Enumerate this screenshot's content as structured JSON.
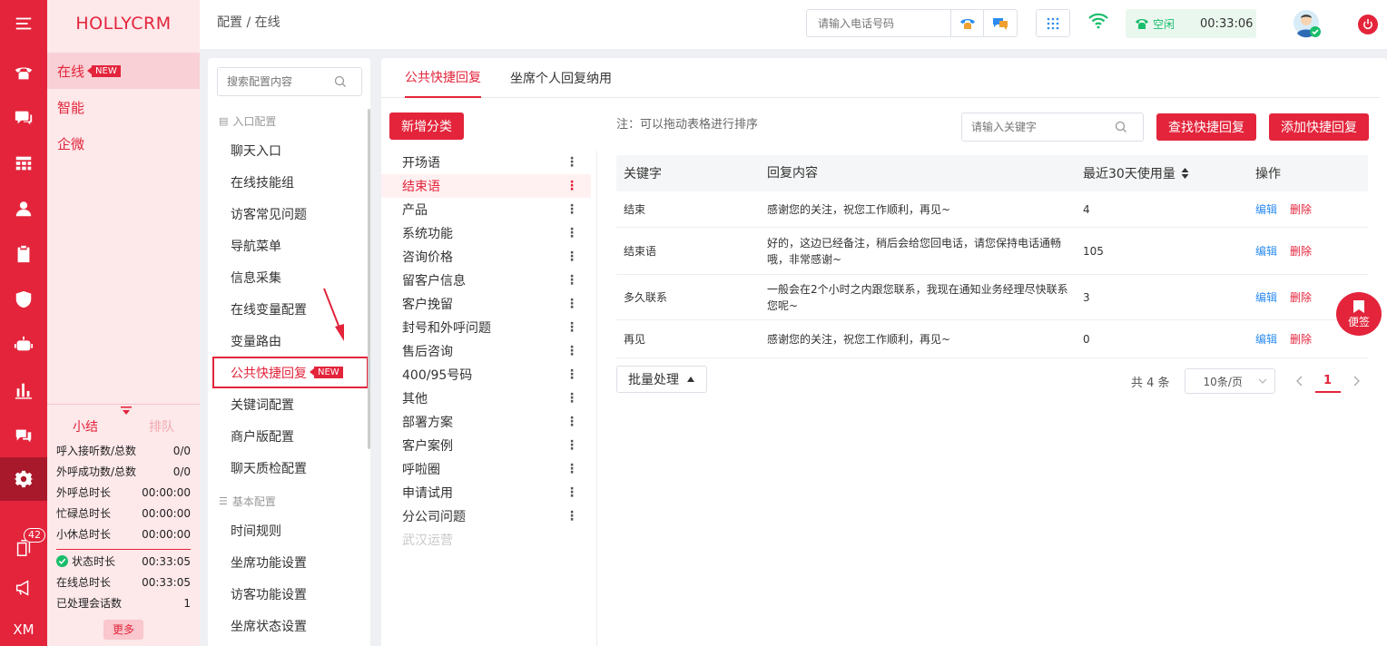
{
  "brand": "HOLLYCRM",
  "breadcrumb": "配置 / 在线",
  "header": {
    "phone_placeholder": "请输入电话号码",
    "status_text": "空闲",
    "status_time": "00:33:06",
    "status_color": "#19be6b"
  },
  "rail": {
    "badge": "42",
    "bottom_label": "XM"
  },
  "nav": {
    "items": [
      {
        "label": "在线",
        "tag": "NEW"
      },
      {
        "label": "智能"
      },
      {
        "label": "企微"
      }
    ]
  },
  "stats": {
    "tab_summary": "小结",
    "tab_queue": "排队",
    "rows": [
      {
        "label": "呼入接听数/总数",
        "value": "0/0"
      },
      {
        "label": "外呼成功数/总数",
        "value": "0/0"
      },
      {
        "label": "外呼总时长",
        "value": "00:00:00"
      },
      {
        "label": "忙碌总时长",
        "value": "00:00:00"
      },
      {
        "label": "小休总时长",
        "value": "00:00:00"
      }
    ],
    "rows2": [
      {
        "label": "状态时长",
        "value": "00:33:05"
      },
      {
        "label": "在线总时长",
        "value": "00:33:05"
      },
      {
        "label": "已处理会话数",
        "value": "1"
      }
    ],
    "more": "更多"
  },
  "config": {
    "search_placeholder": "搜索配置内容",
    "group1": "入口配置",
    "group1_items": [
      "聊天入口",
      "在线技能组",
      "访客常见问题",
      "导航菜单",
      "信息采集",
      "在线变量配置",
      "变量路由",
      "公共快捷回复",
      "关键词配置",
      "商户版配置",
      "聊天质检配置"
    ],
    "selected_tag": "NEW",
    "group2": "基本配置",
    "group2_items": [
      "时间规则",
      "坐席功能设置",
      "访客功能设置",
      "坐席状态设置"
    ]
  },
  "main": {
    "tabs": [
      "公共快捷回复",
      "坐席个人回复纳用"
    ],
    "add_category": "新增分类",
    "categories": [
      "开场语",
      "结束语",
      "产品",
      "系统功能",
      "咨询价格",
      "留客户信息",
      "客户挽留",
      "封号和外呼问题",
      "售后咨询",
      "400/95号码",
      "其他",
      "部署方案",
      "客户案例",
      "呼啦圈",
      "申请试用",
      "分公司问题"
    ],
    "disabled_category": "武汉运营",
    "note": "注：可以拖动表格进行排序",
    "keyword_placeholder": "请输入关键字",
    "find_button": "查找快捷回复",
    "add_button": "添加快捷回复",
    "table": {
      "headers": [
        "关键字",
        "回复内容",
        "最近30天使用量",
        "操作"
      ],
      "rows": [
        {
          "keyword": "结束",
          "content": "感谢您的关注，祝您工作顺利，再见~",
          "usage": "4"
        },
        {
          "keyword": "结束语",
          "content": "好的，这边已经备注，稍后会给您回电话，请您保持电话通畅哦，非常感谢~",
          "usage": "105"
        },
        {
          "keyword": "多久联系",
          "content": "一般会在2个小时之内跟您联系，我现在通知业务经理尽快联系您呢~",
          "usage": "3"
        },
        {
          "keyword": "再见",
          "content": "感谢您的关注，祝您工作顺利，再见~",
          "usage": "0"
        }
      ],
      "edit": "编辑",
      "delete": "删除"
    },
    "batch": "批量处理",
    "pager": {
      "total": "共 4 条",
      "page_size": "10条/页",
      "current": "1"
    },
    "notepad": "便签"
  },
  "colors": {
    "brand": "#e3243b",
    "link": "#2d8cf0"
  }
}
